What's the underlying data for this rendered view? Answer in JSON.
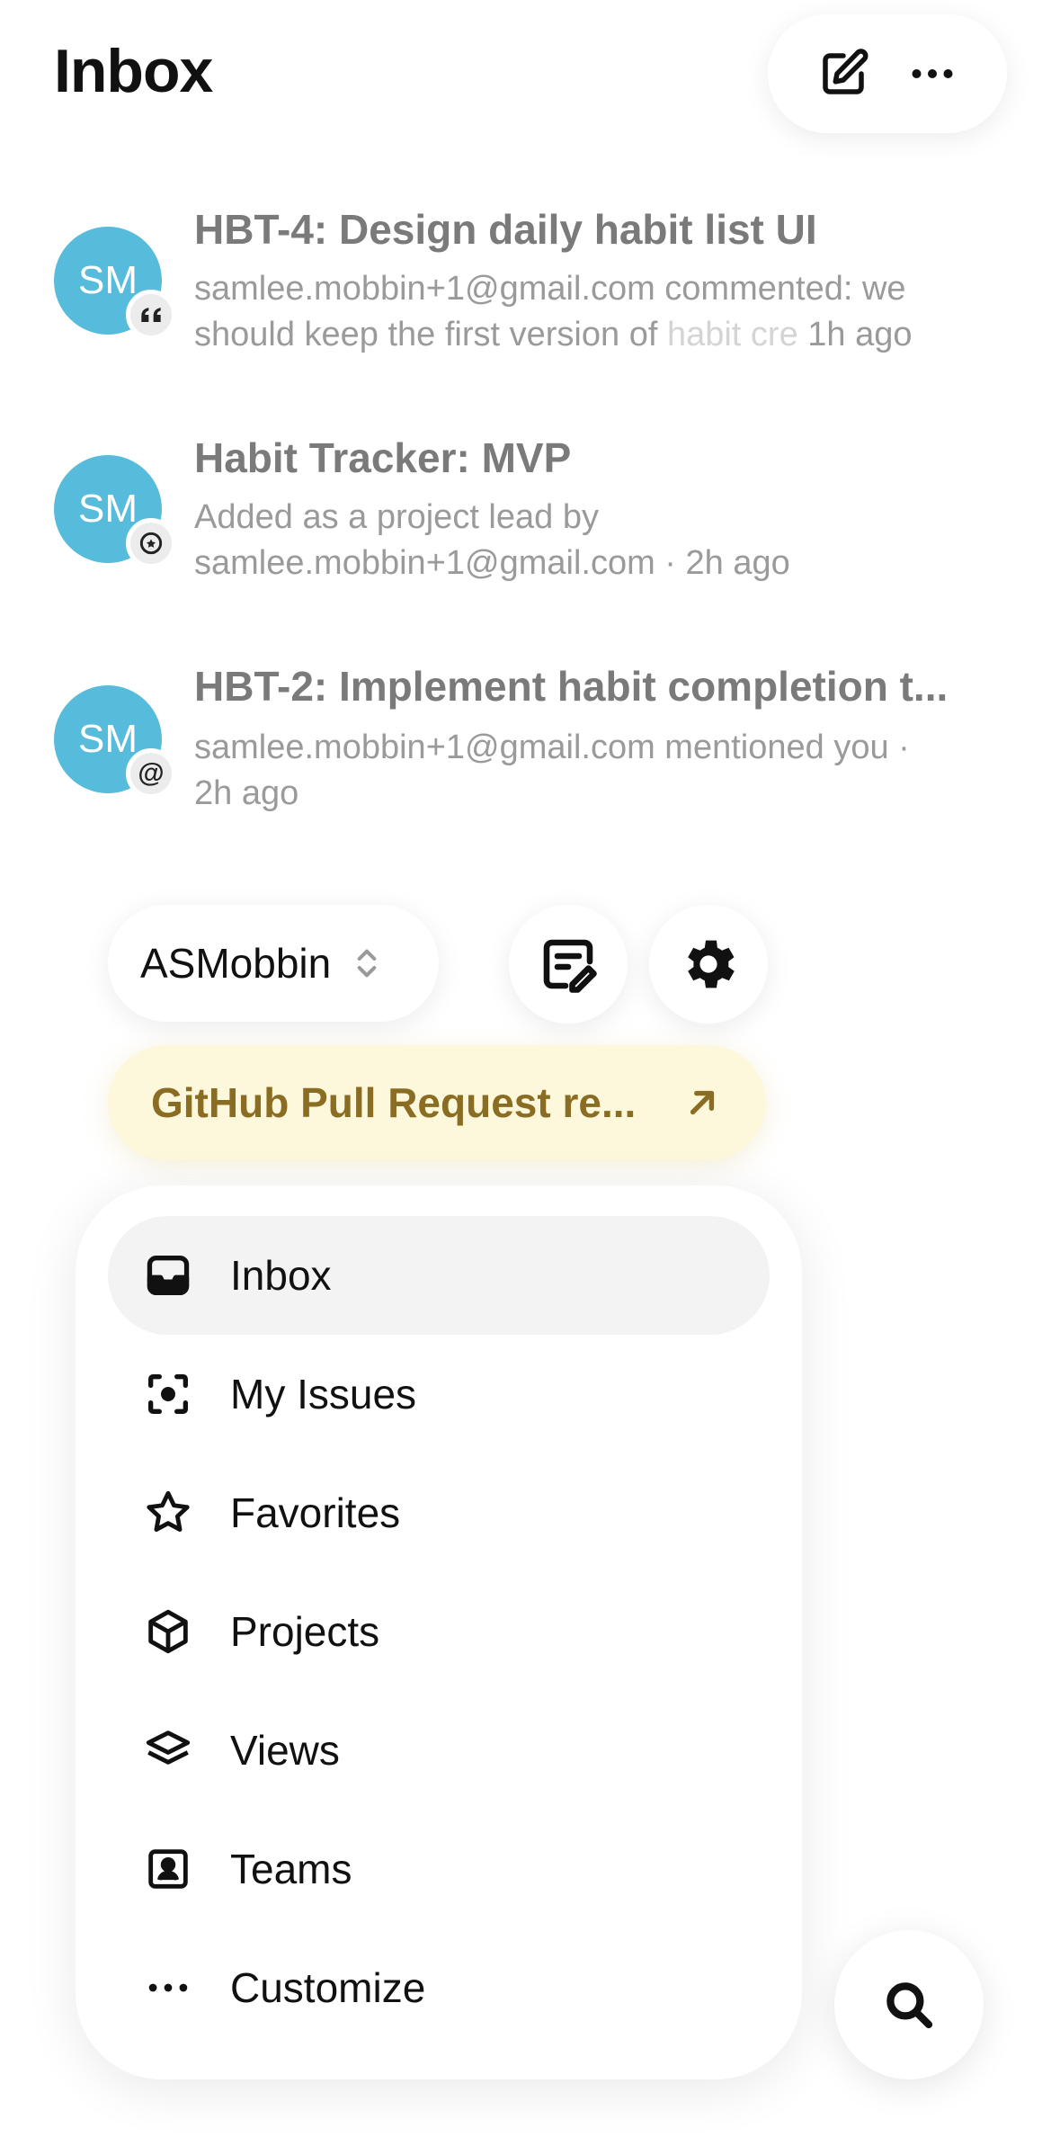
{
  "header": {
    "title": "Inbox",
    "compose_icon": "compose-icon",
    "more_icon": "more-icon"
  },
  "inbox": [
    {
      "avatar_initials": "SM",
      "badge_icon": "quote-icon",
      "title": "HBT-4: Design daily habit list UI",
      "body_line1": "samlee.mobbin+1@gmail.com commented: we",
      "body_line2_a": "should keep the first version of ",
      "body_line2_fade": "habit cre",
      "time": "1h ago"
    },
    {
      "avatar_initials": "SM",
      "badge_icon": "project-lead-icon",
      "title": "Habit Tracker: MVP",
      "body_line1": "Added as a project lead by",
      "body_line2": "samlee.mobbin+1@gmail.com · 2h ago"
    },
    {
      "avatar_initials": "SM",
      "badge_icon": "mention-icon",
      "badge_text": "@",
      "title": "HBT-2: Implement habit completion t...",
      "body_line1": "samlee.mobbin+1@gmail.com mentioned you ·",
      "body_line2": "2h ago"
    }
  ],
  "workspace": {
    "name": "ASMobbin",
    "switcher_icon": "chevron-up-down-icon"
  },
  "promo": {
    "label": "GitHub Pull Request re...",
    "icon": "arrow-up-right-icon"
  },
  "nav": [
    {
      "label": "Inbox",
      "icon": "inbox-icon",
      "active": true
    },
    {
      "label": "My Issues",
      "icon": "focus-icon"
    },
    {
      "label": "Favorites",
      "icon": "star-icon"
    },
    {
      "label": "Projects",
      "icon": "cube-icon"
    },
    {
      "label": "Views",
      "icon": "layers-icon"
    },
    {
      "label": "Teams",
      "icon": "team-icon"
    },
    {
      "label": "Customize",
      "icon": "more-icon"
    }
  ],
  "colors": {
    "avatar": "#57bbdc",
    "promo_bg": "#fdf8dc",
    "promo_text": "#8a6d22"
  }
}
